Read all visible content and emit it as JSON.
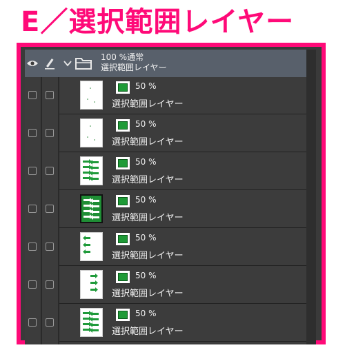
{
  "heading": "E／選択範囲レイヤー",
  "colors": {
    "accent": "#ff0a78",
    "panel": "#3c3c3c",
    "header": "#58606b",
    "mask": "#1e9a36"
  },
  "folder": {
    "opacity_blend": "100 %通常",
    "name": "選択範囲レイヤー",
    "icons": [
      "eye-icon",
      "pen-icon",
      "chevron-down-icon",
      "folder-icon"
    ]
  },
  "layers": [
    {
      "opacity": "50 %",
      "name": "選択範囲レイヤー",
      "thumb": "sparse"
    },
    {
      "opacity": "50 %",
      "name": "選択範囲レイヤー",
      "thumb": "sparse"
    },
    {
      "opacity": "50 %",
      "name": "選択範囲レイヤー",
      "thumb": "arrows"
    },
    {
      "opacity": "50 %",
      "name": "選択範囲レイヤー",
      "thumb": "arrows-dark",
      "selected": true
    },
    {
      "opacity": "50 %",
      "name": "選択範囲レイヤー",
      "thumb": "left-arrows"
    },
    {
      "opacity": "50 %",
      "name": "選択範囲レイヤー",
      "thumb": "right-arrows"
    },
    {
      "opacity": "50 %",
      "name": "選択範囲レイヤー",
      "thumb": "arrows"
    }
  ]
}
